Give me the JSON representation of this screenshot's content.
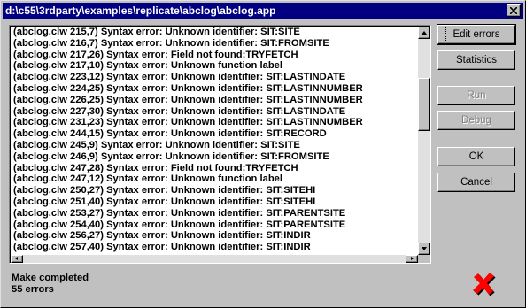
{
  "window": {
    "title": "d:\\c55\\3rdparty\\examples\\replicate\\abclog\\abclog.app"
  },
  "errors": [
    "(abclog.clw 215,7) Syntax error: Unknown identifier: SIT:SITE",
    "(abclog.clw 216,7) Syntax error: Unknown identifier: SIT:FROMSITE",
    "(abclog.clw 217,26) Syntax error: Field not found:TRYFETCH",
    "(abclog.clw 217,10) Syntax error: Unknown function label",
    "(abclog.clw 223,12) Syntax error: Unknown identifier: SIT:LASTINDATE",
    "(abclog.clw 224,25) Syntax error: Unknown identifier: SIT:LASTINNUMBER",
    "(abclog.clw 226,25) Syntax error: Unknown identifier: SIT:LASTINNUMBER",
    "(abclog.clw 227,30) Syntax error: Unknown identifier: SIT:LASTINDATE",
    "(abclog.clw 231,23) Syntax error: Unknown identifier: SIT:LASTINNUMBER",
    "(abclog.clw 244,15) Syntax error: Unknown identifier: SIT:RECORD",
    "(abclog.clw 245,9) Syntax error: Unknown identifier: SIT:SITE",
    "(abclog.clw 246,9) Syntax error: Unknown identifier: SIT:FROMSITE",
    "(abclog.clw 247,28) Syntax error: Field not found:TRYFETCH",
    "(abclog.clw 247,12) Syntax error: Unknown function label",
    "(abclog.clw 250,27) Syntax error: Unknown identifier: SIT:SITEHI",
    "(abclog.clw 251,40) Syntax error: Unknown identifier: SIT:SITEHI",
    "(abclog.clw 253,27) Syntax error: Unknown identifier: SIT:PARENTSITE",
    "(abclog.clw 254,40) Syntax error: Unknown identifier: SIT:PARENTSITE",
    "(abclog.clw 256,27) Syntax error: Unknown identifier: SIT:INDIR",
    "(abclog.clw 257,40) Syntax error: Unknown identifier: SIT:INDIR"
  ],
  "buttons": {
    "edit_errors": "Edit errors",
    "statistics": "Statistics",
    "run": "Run",
    "debug": "Debug",
    "ok": "OK",
    "cancel": "Cancel"
  },
  "status": {
    "line1": "Make completed",
    "line2": "55 errors"
  },
  "icons": {
    "close": "close-x-icon",
    "error": "red-x-error-icon"
  },
  "colors": {
    "titlebar": "#000080",
    "error_red": "#ff0000"
  }
}
